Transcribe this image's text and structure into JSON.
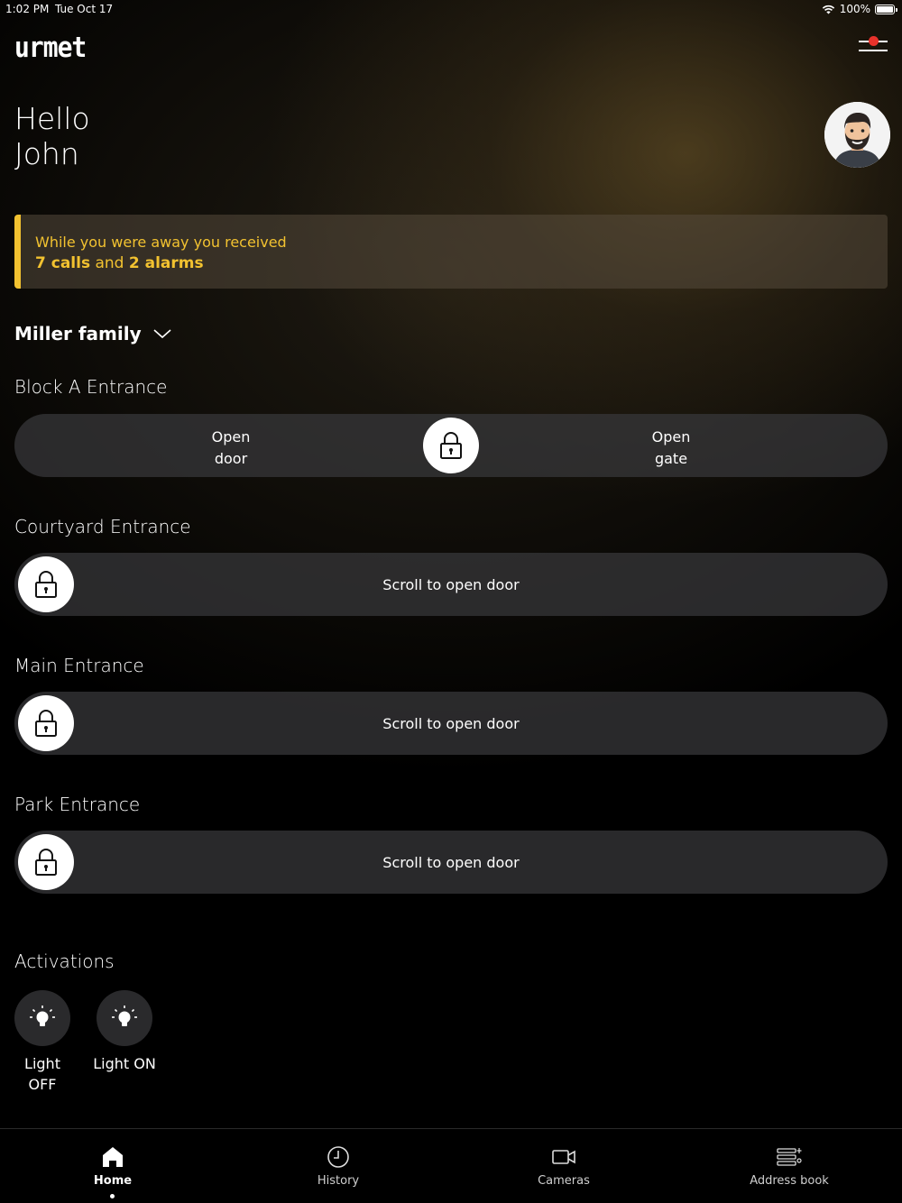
{
  "status_bar": {
    "time": "1:02 PM",
    "date": "Tue Oct 17",
    "battery": "100%"
  },
  "header": {
    "logo": "urmet"
  },
  "greeting": {
    "line1": "Hello",
    "line2": "John"
  },
  "notice": {
    "line1": "While you were away you received",
    "calls": "7 calls",
    "and": "and",
    "alarms": "2 alarms",
    "accent_color": "#f2c230"
  },
  "family_selector": {
    "label": "Miller family"
  },
  "entrances": [
    {
      "title": "Block A Entrance",
      "left_label_1": "Open",
      "left_label_2": "door",
      "right_label_1": "Open",
      "right_label_2": "gate"
    },
    {
      "title": "Courtyard Entrance",
      "slider_label": "Scroll to open door"
    },
    {
      "title": "Main Entrance",
      "slider_label": "Scroll to open door"
    },
    {
      "title": "Park Entrance",
      "slider_label": "Scroll to open door"
    }
  ],
  "activations": {
    "title": "Activations",
    "items": [
      {
        "label_1": "Light",
        "label_2": "OFF"
      },
      {
        "label_1": "Light ON",
        "label_2": ""
      }
    ]
  },
  "tabs": [
    {
      "label": "Home",
      "icon": "home-icon",
      "active": true
    },
    {
      "label": "History",
      "icon": "clock-icon",
      "active": false
    },
    {
      "label": "Cameras",
      "icon": "camera-icon",
      "active": false
    },
    {
      "label": "Address book",
      "icon": "address-book-icon",
      "active": false
    }
  ]
}
